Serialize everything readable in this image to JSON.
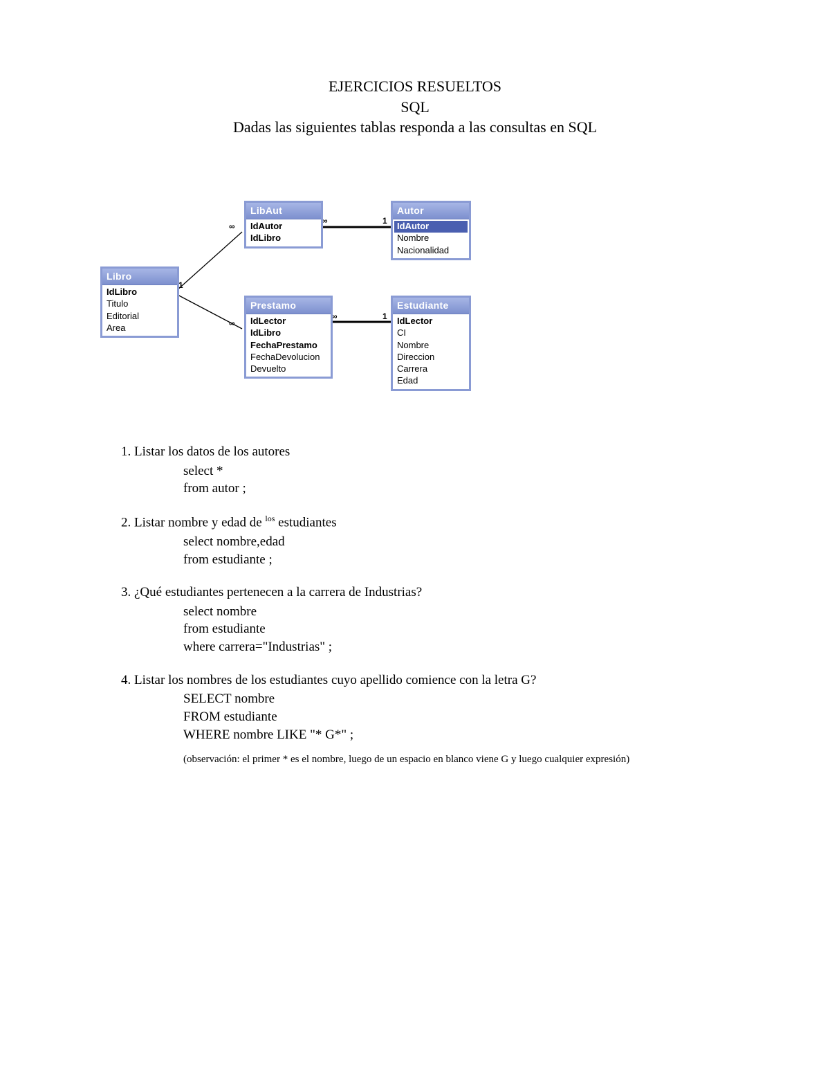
{
  "header": {
    "line1": "EJERCICIOS RESUELTOS",
    "line2": "SQL",
    "line3": "Dadas las siguientes tablas responda a las consultas en SQL"
  },
  "tables": {
    "libro": {
      "title": "Libro",
      "fields": [
        {
          "name": "IdLibro",
          "bold": true
        },
        {
          "name": "Titulo"
        },
        {
          "name": "Editorial"
        },
        {
          "name": "Area"
        }
      ]
    },
    "libaut": {
      "title": "LibAut",
      "fields": [
        {
          "name": "IdAutor",
          "bold": true
        },
        {
          "name": "IdLibro",
          "bold": true
        }
      ]
    },
    "autor": {
      "title": "Autor",
      "fields": [
        {
          "name": "IdAutor",
          "selected": true
        },
        {
          "name": "Nombre"
        },
        {
          "name": "Nacionalidad"
        }
      ]
    },
    "prestamo": {
      "title": "Prestamo",
      "fields": [
        {
          "name": "IdLector",
          "bold": true
        },
        {
          "name": "IdLibro",
          "bold": true
        },
        {
          "name": "FechaPrestamo",
          "bold": true
        },
        {
          "name": "FechaDevolucion"
        },
        {
          "name": "Devuelto"
        }
      ]
    },
    "estudiante": {
      "title": "Estudiante",
      "fields": [
        {
          "name": "IdLector",
          "bold": true
        },
        {
          "name": "CI"
        },
        {
          "name": "Nombre"
        },
        {
          "name": "Direccion"
        },
        {
          "name": "Carrera"
        },
        {
          "name": "Edad"
        }
      ]
    }
  },
  "relations": {
    "one": "1",
    "many": "∞"
  },
  "exercises": [
    {
      "num": "1.",
      "question": "Listar los datos de los autores",
      "code": "select *\nfrom autor ;"
    },
    {
      "num": "2.",
      "question_pre": "Listar nombre y edad de ",
      "question_sup": "los",
      "question_post": " estudiantes",
      "code": "select nombre,edad\nfrom estudiante ;"
    },
    {
      "num": "3.",
      "question": "¿Qué estudiantes pertenecen a la carrera de Industrias?",
      "code": "select nombre\nfrom estudiante\nwhere carrera=\"Industrias\" ;"
    },
    {
      "num": "4.",
      "question": "Listar los nombres de los estudiantes cuyo apellido comience con la letra G?",
      "code": "SELECT nombre\nFROM estudiante\nWHERE nombre LIKE \"* G*\" ;",
      "observation": "(observación:   el primer * es el nombre, luego de un espacio en blanco viene G y luego cualquier expresión)"
    }
  ]
}
